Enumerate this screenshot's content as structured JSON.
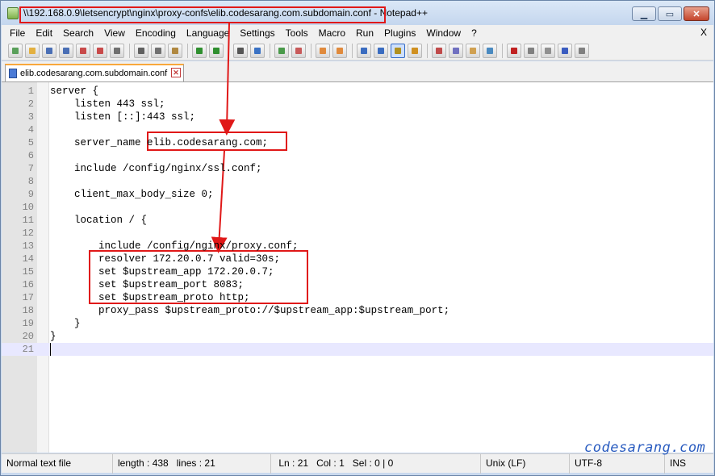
{
  "window": {
    "title": "\\\\192.168.0.9\\letsencrypt\\nginx\\proxy-confs\\elib.codesarang.com.subdomain.conf - Notepad++",
    "minimize_label": "▁",
    "maximize_label": "▭",
    "close_label": "✕"
  },
  "menubar": {
    "items": [
      "File",
      "Edit",
      "Search",
      "View",
      "Encoding",
      "Language",
      "Settings",
      "Tools",
      "Macro",
      "Run",
      "Plugins",
      "Window",
      "?"
    ],
    "close_label": "X"
  },
  "toolbar": {
    "icons": [
      "new-file-icon",
      "open-file-icon",
      "save-icon",
      "save-all-icon",
      "close-icon",
      "close-all-icon",
      "print-icon",
      "cut-icon",
      "copy-icon",
      "paste-icon",
      "undo-icon",
      "redo-icon",
      "find-icon",
      "replace-icon",
      "zoom-in-icon",
      "zoom-out-icon",
      "sync-vertical-icon",
      "sync-horizontal-icon",
      "word-wrap-icon",
      "show-all-chars-icon",
      "indent-guide-icon",
      "language-icon",
      "document-map-icon",
      "function-list-icon",
      "folder-workspace-icon",
      "monitoring-icon",
      "record-macro-icon",
      "stop-macro-icon",
      "play-macro-icon",
      "run-macro-multiple-icon",
      "save-macro-icon"
    ]
  },
  "tab": {
    "label": "elib.codesarang.com.subdomain.conf",
    "close_label": "✕"
  },
  "editor": {
    "lines": [
      {
        "n": "1",
        "text": "server {"
      },
      {
        "n": "2",
        "text": "    listen 443 ssl;"
      },
      {
        "n": "3",
        "text": "    listen [::]:443 ssl;"
      },
      {
        "n": "4",
        "text": ""
      },
      {
        "n": "5",
        "text": "    server_name elib.codesarang.com;"
      },
      {
        "n": "6",
        "text": ""
      },
      {
        "n": "7",
        "text": "    include /config/nginx/ssl.conf;"
      },
      {
        "n": "8",
        "text": ""
      },
      {
        "n": "9",
        "text": "    client_max_body_size 0;"
      },
      {
        "n": "10",
        "text": ""
      },
      {
        "n": "11",
        "text": "    location / {"
      },
      {
        "n": "12",
        "text": ""
      },
      {
        "n": "13",
        "text": "        include /config/nginx/proxy.conf;"
      },
      {
        "n": "14",
        "text": "        resolver 172.20.0.7 valid=30s;"
      },
      {
        "n": "15",
        "text": "        set $upstream_app 172.20.0.7;"
      },
      {
        "n": "16",
        "text": "        set $upstream_port 8083;"
      },
      {
        "n": "17",
        "text": "        set $upstream_proto http;"
      },
      {
        "n": "18",
        "text": "        proxy_pass $upstream_proto://$upstream_app:$upstream_port;"
      },
      {
        "n": "19",
        "text": "    }"
      },
      {
        "n": "20",
        "text": "}"
      },
      {
        "n": "21",
        "text": ""
      }
    ],
    "current_line": "21"
  },
  "statusbar": {
    "file_type": "Normal text file",
    "length": "length : 438",
    "lines": "lines : 21",
    "ln": "Ln : 21",
    "col": "Col : 1",
    "sel": "Sel : 0 | 0",
    "eol": "Unix (LF)",
    "encoding": "UTF-8",
    "mode": "INS"
  },
  "watermark": "codesarang.com",
  "colors": {
    "annotation": "#e01818",
    "current_line": "#e8e8ff",
    "tab_accent": "#f9a83c"
  }
}
